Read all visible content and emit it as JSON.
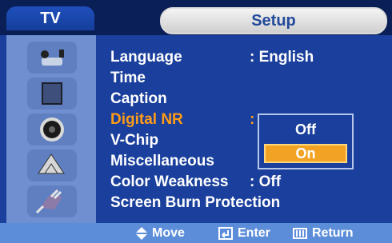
{
  "header": {
    "left_tab": "TV",
    "title": "Setup"
  },
  "menu": {
    "items": [
      {
        "label": "Language",
        "value": ":  English",
        "selected": false
      },
      {
        "label": "Time",
        "value": "",
        "selected": false
      },
      {
        "label": "Caption",
        "value": "",
        "selected": false
      },
      {
        "label": "Digital NR",
        "value": ":",
        "selected": true
      },
      {
        "label": "V-Chip",
        "value": "",
        "selected": false
      },
      {
        "label": "Miscellaneous",
        "value": "",
        "selected": false
      },
      {
        "label": "Color Weakness",
        "value": ":  Off",
        "selected": false
      },
      {
        "label": "Screen Burn Protection",
        "value": "",
        "selected": false
      }
    ],
    "popup": {
      "options": [
        "Off",
        "On"
      ],
      "selected_index": 1
    }
  },
  "footer": {
    "move": "Move",
    "enter": "Enter",
    "return": "Return"
  },
  "sidebar": {
    "icons": [
      "antenna-icon",
      "panel-icon",
      "speaker-icon",
      "satellite-dish-icon",
      "plug-icon"
    ]
  },
  "colors": {
    "background": "#1a3f9c",
    "selected_text": "#ff9c18",
    "popup_highlight": "#f3a324"
  }
}
